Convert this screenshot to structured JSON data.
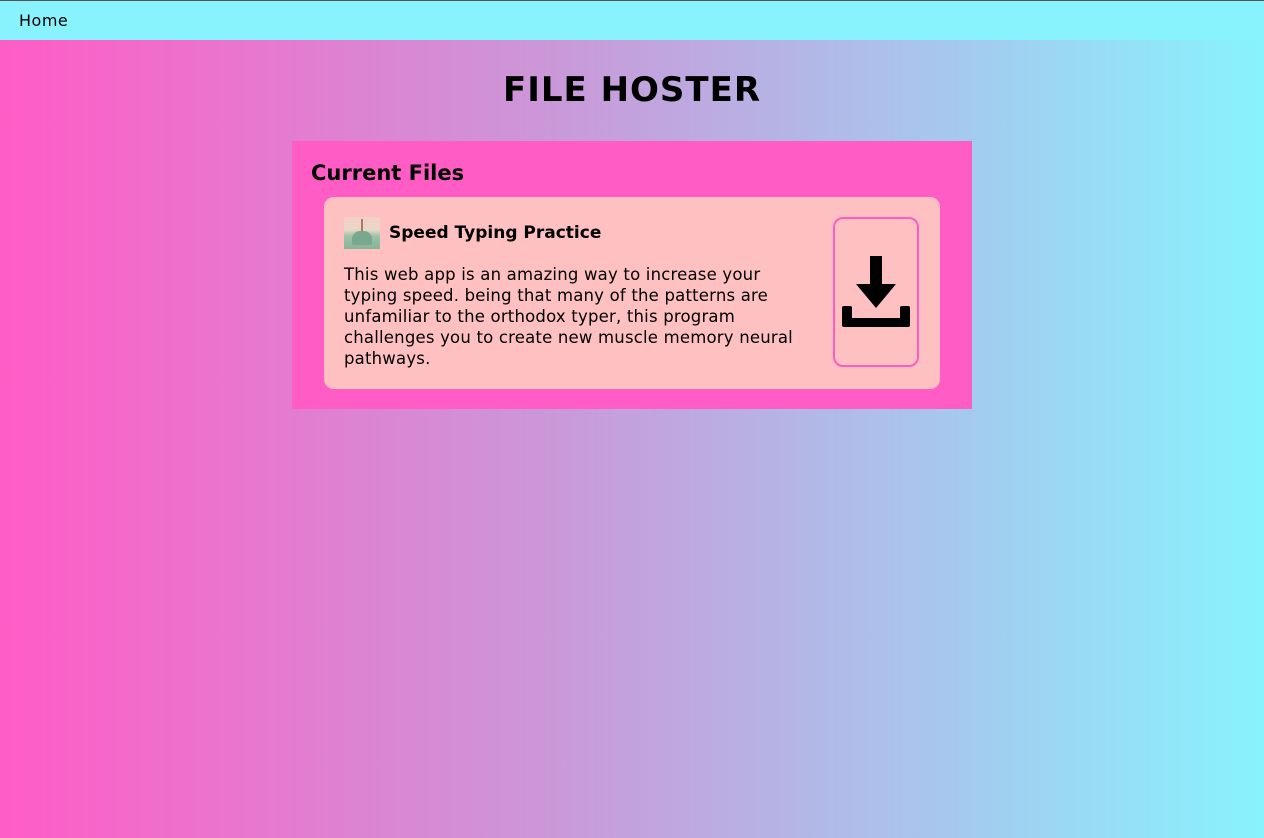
{
  "nav": {
    "home_label": "Home"
  },
  "page": {
    "title": "FILE HOSTER"
  },
  "files_panel": {
    "heading": "Current Files",
    "files": [
      {
        "name": "Speed Typing Practice",
        "description": "This web app is an amazing way to increase your typing speed. being that many of the patterns are unfamiliar to the orthodox typer, this program challenges you to create new muscle memory neural pathways.",
        "thumbnail_icon": "file-thumbnail-image",
        "action_icon": "download-icon"
      }
    ]
  },
  "colors": {
    "gradient_left": "#ff5cc6",
    "gradient_right": "#88f3fd",
    "navbar": "#88f3fd",
    "panel": "#ff5cc6",
    "card": "#fec0c0",
    "button_border": "#ff5cc6"
  }
}
